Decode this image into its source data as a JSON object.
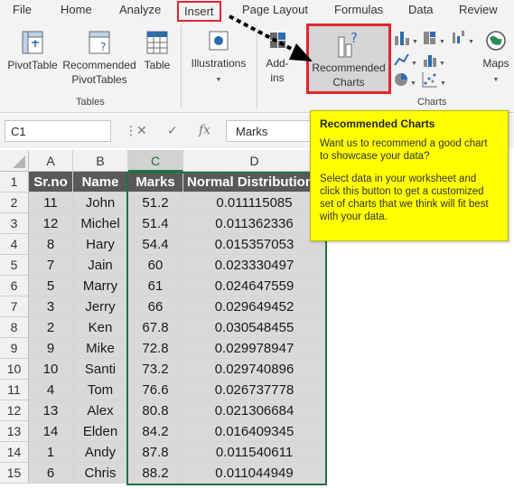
{
  "ribbon": {
    "tabs": [
      "File",
      "Home",
      "Analyze",
      "Insert",
      "Page Layout",
      "Formulas",
      "Data",
      "Review"
    ],
    "active_tab": "Insert",
    "buttons": {
      "pivottable": "PivotTable",
      "recommended_pivottables_line1": "Recommended",
      "recommended_pivottables_line2": "PivotTables",
      "table": "Table",
      "illustrations": "Illustrations",
      "addins_line1": "Add-",
      "addins_line2": "ins",
      "recommended_charts_line1": "Recommended",
      "recommended_charts_line2": "Charts",
      "maps": "Maps"
    },
    "groups": {
      "tables": "Tables",
      "charts": "Charts"
    }
  },
  "formula_bar": {
    "name_box": "C1",
    "fx_label": "fx",
    "content": "Marks"
  },
  "sheet": {
    "columns": [
      "A",
      "B",
      "C",
      "D"
    ],
    "selected_column": "C",
    "headers": [
      "Sr.no",
      "Name",
      "Marks",
      "Normal  Distribution"
    ],
    "rows": [
      {
        "n": "1"
      },
      {
        "n": "2",
        "a": "11",
        "b": "John",
        "c": "51.2",
        "d": "0.011115085"
      },
      {
        "n": "3",
        "a": "12",
        "b": "Michel",
        "c": "51.4",
        "d": "0.011362336"
      },
      {
        "n": "4",
        "a": "8",
        "b": "Hary",
        "c": "54.4",
        "d": "0.015357053"
      },
      {
        "n": "5",
        "a": "7",
        "b": "Jain",
        "c": "60",
        "d": "0.023330497"
      },
      {
        "n": "6",
        "a": "5",
        "b": "Marry",
        "c": "61",
        "d": "0.024647559"
      },
      {
        "n": "7",
        "a": "3",
        "b": "Jerry",
        "c": "66",
        "d": "0.029649452"
      },
      {
        "n": "8",
        "a": "2",
        "b": "Ken",
        "c": "67.8",
        "d": "0.030548455"
      },
      {
        "n": "9",
        "a": "9",
        "b": "Mike",
        "c": "72.8",
        "d": "0.029978947"
      },
      {
        "n": "10",
        "a": "10",
        "b": "Santi",
        "c": "73.2",
        "d": "0.029740896"
      },
      {
        "n": "11",
        "a": "4",
        "b": "Tom",
        "c": "76.6",
        "d": "0.026737778"
      },
      {
        "n": "12",
        "a": "13",
        "b": "Alex",
        "c": "80.8",
        "d": "0.021306684"
      },
      {
        "n": "13",
        "a": "14",
        "b": "Elden",
        "c": "84.2",
        "d": "0.016409345"
      },
      {
        "n": "14",
        "a": "1",
        "b": "Andy",
        "c": "87.8",
        "d": "0.011540611"
      },
      {
        "n": "15",
        "a": "6",
        "b": "Chris",
        "c": "88.2",
        "d": "0.011044949"
      }
    ]
  },
  "tooltip": {
    "title": "Recommended Charts",
    "para1": "Want us to recommend a good chart to showcase your data?",
    "para2": "Select data in your worksheet and click this button to get a customized set of charts that we think will fit best with your data."
  },
  "colors": {
    "header_fill": "#595959",
    "data_fill": "#d9d9d9",
    "selection": "#217346",
    "highlight_box": "#e0262f",
    "tooltip_bg": "#ffff00"
  }
}
